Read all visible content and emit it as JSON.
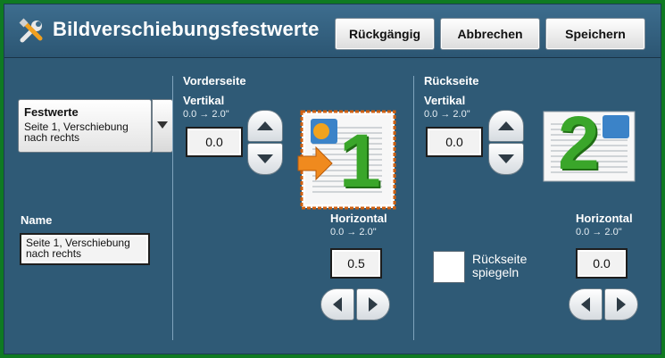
{
  "header": {
    "title": "Bildverschiebungsfestwerte",
    "undo_label": "Rückgängig",
    "cancel_label": "Abbrechen",
    "save_label": "Speichern"
  },
  "presets": {
    "label": "Festwerte",
    "value": "Seite 1, Verschiebung nach rechts"
  },
  "name": {
    "label": "Name",
    "value": "Seite 1, Verschiebung nach rechts"
  },
  "front": {
    "section_label": "Vorderseite",
    "vertical_label": "Vertikal",
    "vertical_range": "0.0 → 2.0\"",
    "vertical_value": "0.0",
    "horizontal_label": "Horizontal",
    "horizontal_range": "0.0 → 2.0\"",
    "horizontal_value": "0.5",
    "page_number": "1"
  },
  "back": {
    "section_label": "Rückseite",
    "vertical_label": "Vertikal",
    "vertical_range": "0.0 → 2.0\"",
    "vertical_value": "0.0",
    "horizontal_label": "Horizontal",
    "horizontal_range": "0.0 → 2.0\"",
    "horizontal_value": "0.0",
    "page_number": "2",
    "mirror_label": "Rückseite spiegeln",
    "mirror_checked": false
  },
  "colors": {
    "panel": "#2f5a76",
    "frame": "#0f7a22",
    "digit_green": "#3aa62a",
    "arrow_orange": "#f08a1e"
  }
}
